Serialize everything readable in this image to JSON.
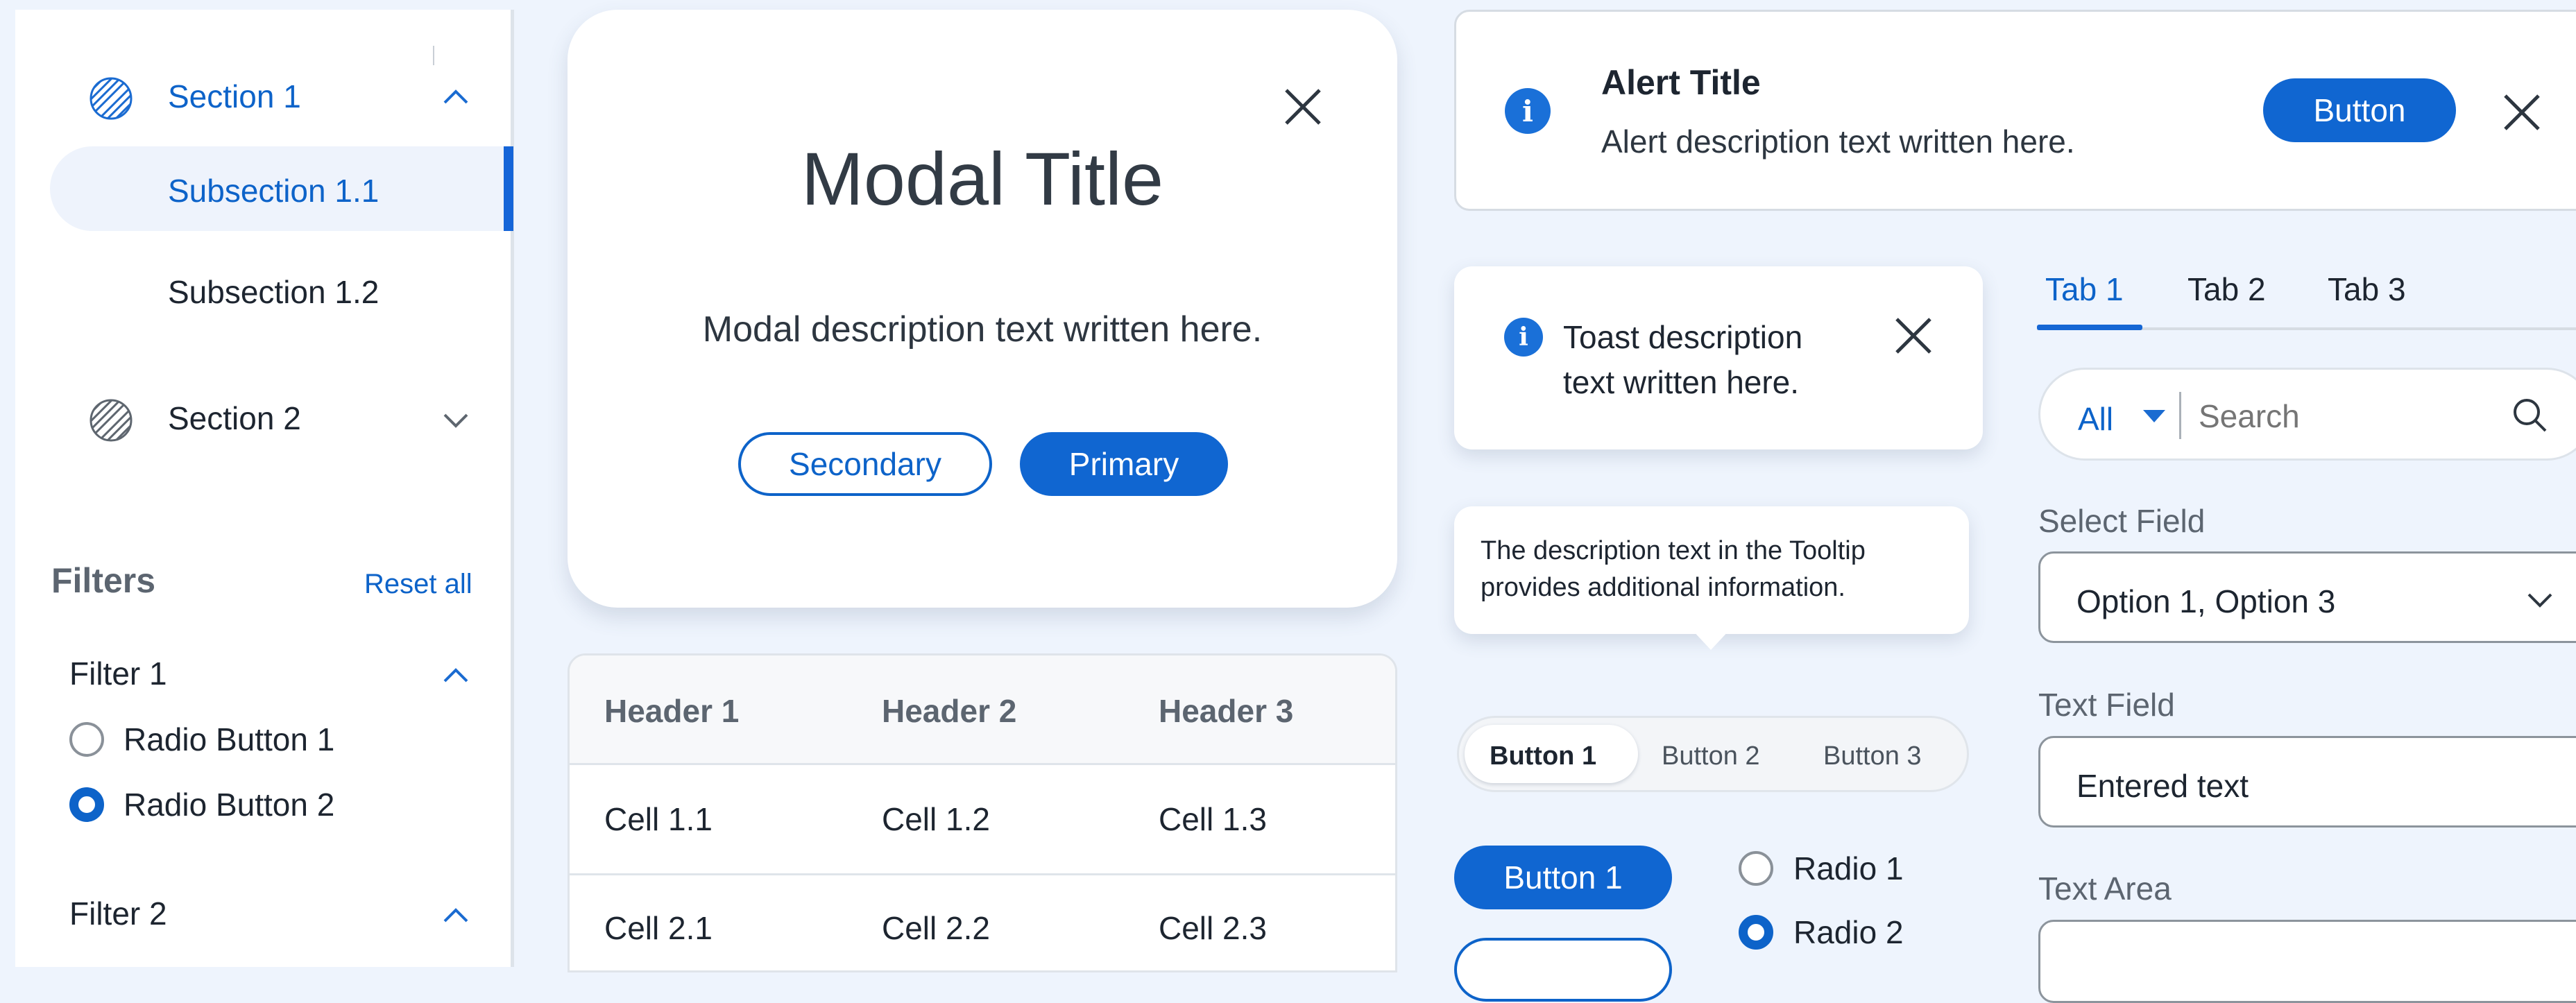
{
  "colors": {
    "accent": "#0d63c9",
    "page_bg": "#eef4fd",
    "muted_text": "#5c6570"
  },
  "sidebar": {
    "sections": [
      {
        "label": "Section 1",
        "icon": "hatched-circle-icon",
        "state": "expanded"
      },
      {
        "label": "Section 2",
        "icon": "hatched-circle-icon",
        "state": "collapsed"
      }
    ],
    "subsections": [
      {
        "label": "Subsection 1.1",
        "selected": true
      },
      {
        "label": "Subsection 1.2",
        "selected": false
      }
    ],
    "filters": {
      "title": "Filters",
      "reset_label": "Reset all",
      "groups": [
        {
          "label": "Filter 1",
          "options": [
            {
              "label": "Radio Button 1",
              "selected": false
            },
            {
              "label": "Radio Button 2",
              "selected": true
            }
          ]
        },
        {
          "label": "Filter 2"
        }
      ]
    }
  },
  "modal": {
    "title": "Modal Title",
    "description": "Modal description text written here.",
    "secondary_label": "Secondary",
    "primary_label": "Primary"
  },
  "table": {
    "headers": [
      "Header 1",
      "Header 2",
      "Header 3"
    ],
    "rows": [
      [
        "Cell 1.1",
        "Cell 1.2",
        "Cell 1.3"
      ],
      [
        "Cell 2.1",
        "Cell 2.2",
        "Cell 2.3"
      ]
    ]
  },
  "alert": {
    "title": "Alert Title",
    "description": "Alert description text written here.",
    "button_label": "Button"
  },
  "toast": {
    "line1": "Toast description",
    "line2": "text written here."
  },
  "tooltip": {
    "line1": "The description text in the Tooltip",
    "line2": "provides additional information."
  },
  "segmented": {
    "items": [
      "Button 1",
      "Button 2",
      "Button 3"
    ],
    "selected_index": 0
  },
  "buttons": {
    "button1_label": "Button 1"
  },
  "radios": [
    {
      "label": "Radio 1",
      "selected": false
    },
    {
      "label": "Radio 2",
      "selected": true
    }
  ],
  "tabs": {
    "items": [
      "Tab 1",
      "Tab 2",
      "Tab 3"
    ],
    "selected_index": 0
  },
  "search": {
    "scope": "All",
    "placeholder": "Search"
  },
  "select_field": {
    "label": "Select Field",
    "value": "Option 1, Option 3"
  },
  "text_field": {
    "label": "Text Field",
    "value": "Entered text"
  },
  "text_area": {
    "label": "Text Area"
  }
}
